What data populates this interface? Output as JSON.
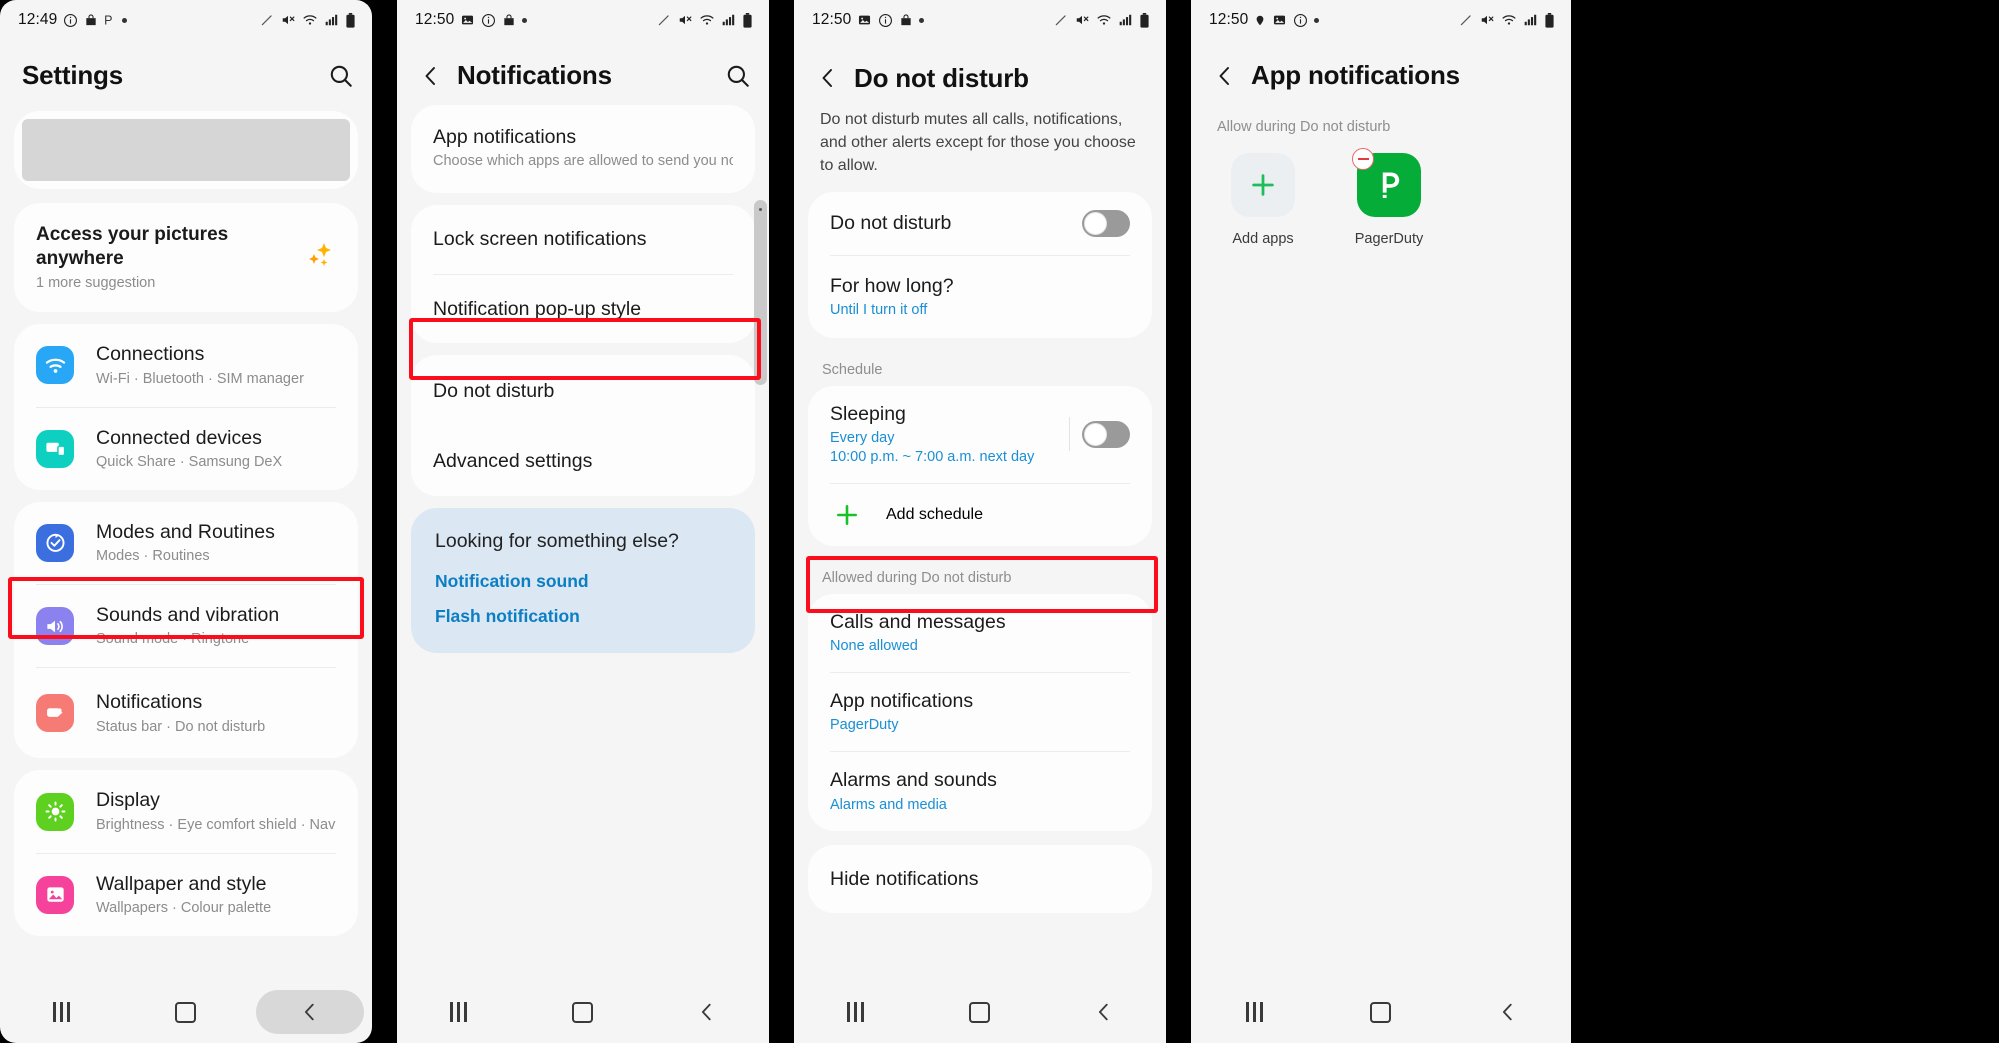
{
  "panels": {
    "settings": {
      "status": {
        "time": "12:49",
        "icons": [
          "info-icon",
          "bag-icon",
          "p-icon",
          "dot-icon"
        ],
        "right_icons": [
          "pen-icon",
          "mute-icon",
          "wifi-icon",
          "signal-icon",
          "battery-icon"
        ]
      },
      "title": "Settings",
      "search_icon": "search-icon",
      "suggestion": {
        "title": "Access your pictures anywhere",
        "subtitle": "1 more suggestion",
        "icon": "sparkle-icon"
      },
      "items": [
        {
          "title": "Connections",
          "subtitle": "Wi-Fi  ·  Bluetooth  ·  SIM manager",
          "icon": "wifi-icon",
          "color": "#27a7f5"
        },
        {
          "title": "Connected devices",
          "subtitle": "Quick Share  ·  Samsung DeX",
          "icon": "devices-icon",
          "color": "#0ed0c0"
        },
        {
          "title": "Modes and Routines",
          "subtitle": "Modes  ·  Routines",
          "icon": "check-circle-icon",
          "color": "#3b6fe0"
        },
        {
          "title": "Sounds and vibration",
          "subtitle": "Sound mode  ·  Ringtone",
          "icon": "speaker-icon",
          "color": "#8b82ef"
        },
        {
          "title": "Notifications",
          "subtitle": "Status bar  ·  Do not disturb",
          "icon": "notification-icon",
          "color": "#f77b75"
        },
        {
          "title": "Display",
          "subtitle": "Brightness  ·  Eye comfort shield  ·  Navigation bar",
          "icon": "brightness-icon",
          "color": "#5ed120"
        },
        {
          "title": "Wallpaper and style",
          "subtitle": "Wallpapers  ·  Colour palette",
          "icon": "image-icon",
          "color": "#f5429b"
        }
      ],
      "highlighted_item": "Notifications"
    },
    "notifications": {
      "status": {
        "time": "12:50",
        "icons": [
          "picture-icon",
          "info-icon",
          "bag-icon",
          "dot-icon"
        ],
        "right_icons": [
          "pen-icon",
          "mute-icon",
          "wifi-icon",
          "signal-icon",
          "battery-icon"
        ]
      },
      "title": "Notifications",
      "back_icon": "back-chevron-icon",
      "search_icon": "search-icon",
      "app_notifications": {
        "title": "App notifications",
        "subtitle": "Choose which apps are allowed to send you notifications."
      },
      "items": [
        {
          "title": "Lock screen notifications"
        },
        {
          "title": "Notification pop-up style"
        }
      ],
      "items2": [
        {
          "title": "Do not disturb"
        },
        {
          "title": "Advanced settings"
        }
      ],
      "highlighted_item": "Do not disturb",
      "looking_card": {
        "title": "Looking for something else?",
        "links": [
          "Notification sound",
          "Flash notification"
        ]
      }
    },
    "dnd": {
      "status": {
        "time": "12:50",
        "icons": [
          "picture-icon",
          "info-icon",
          "bag-icon",
          "dot-icon"
        ],
        "right_icons": [
          "pen-icon",
          "mute-icon",
          "wifi-icon",
          "signal-icon",
          "battery-icon"
        ]
      },
      "title": "Do not disturb",
      "back_icon": "back-chevron-icon",
      "description": "Do not disturb mutes all calls, notifications, and other alerts except for those you choose to allow.",
      "master_toggle": {
        "label": "Do not disturb",
        "state": "off"
      },
      "duration": {
        "label": "For how long?",
        "value": "Until I turn it off"
      },
      "schedule_label": "Schedule",
      "schedule": {
        "title": "Sleeping",
        "line1": "Every day",
        "line2": "10:00 p.m. ~ 7:00 a.m. next day",
        "state": "off"
      },
      "add_schedule": {
        "label": "Add schedule",
        "icon": "plus-icon"
      },
      "allowed_label": "Allowed during Do not disturb",
      "allowed": [
        {
          "title": "Calls and messages",
          "value": "None allowed"
        },
        {
          "title": "App notifications",
          "value": "PagerDuty"
        },
        {
          "title": "Alarms and sounds",
          "value": "Alarms and media"
        }
      ],
      "highlighted_item": "App notifications",
      "hide": {
        "title": "Hide notifications"
      }
    },
    "app_notifications": {
      "status": {
        "time": "12:50",
        "icons": [
          "location-icon",
          "picture-icon",
          "info-icon",
          "dot-icon"
        ],
        "right_icons": [
          "pen-icon",
          "mute-icon",
          "wifi-icon",
          "signal-icon",
          "battery-icon"
        ]
      },
      "title": "App notifications",
      "back_icon": "back-chevron-icon",
      "allow_label": "Allow during Do not disturb",
      "apps": [
        {
          "name": "Add apps",
          "icon": "plus-icon",
          "type": "add"
        },
        {
          "name": "PagerDuty",
          "icon": "pagerduty-icon",
          "type": "app",
          "badge": "minus-badge"
        }
      ]
    }
  },
  "navbar": {
    "recents": "recents-icon",
    "home": "home-icon",
    "back": "back-icon"
  },
  "colors": {
    "highlight": "#fc0d1b",
    "link": "#1a8fd4",
    "accent_green": "#06ac38"
  }
}
